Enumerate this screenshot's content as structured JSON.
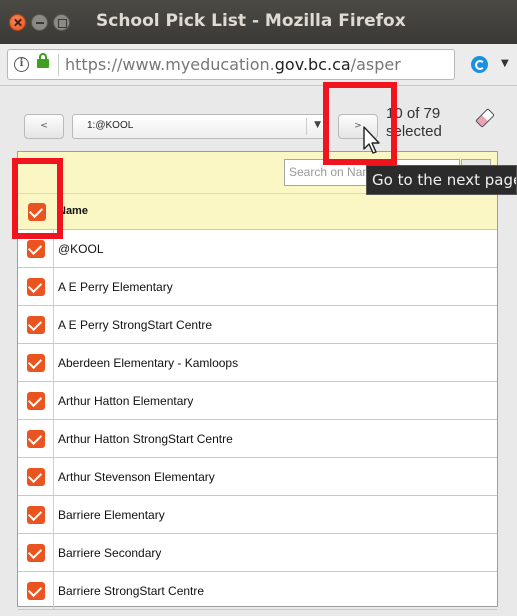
{
  "window": {
    "title": "School Pick List - Mozilla Firefox"
  },
  "urlbar": {
    "url_prefix": "https://www.myeducation.",
    "url_domain": "gov.bc.ca",
    "url_suffix": "/asper"
  },
  "picklist": {
    "prev_label": "<",
    "next_label": ">",
    "selected_option": "1:@KOOL",
    "count_line1": "10 of 79",
    "count_line2": "selected",
    "search_placeholder": "Search on Name",
    "column_header": "Name",
    "header_checked": true,
    "rows": [
      {
        "name": "@KOOL",
        "checked": true
      },
      {
        "name": "A E Perry Elementary",
        "checked": true
      },
      {
        "name": "A E Perry StrongStart Centre",
        "checked": true
      },
      {
        "name": "Aberdeen Elementary - Kamloops",
        "checked": true
      },
      {
        "name": "Arthur Hatton Elementary",
        "checked": true
      },
      {
        "name": "Arthur Hatton StrongStart Centre",
        "checked": true
      },
      {
        "name": "Arthur Stevenson Elementary",
        "checked": true
      },
      {
        "name": "Barriere Elementary",
        "checked": true
      },
      {
        "name": "Barriere Secondary",
        "checked": true
      },
      {
        "name": "Barriere StrongStart Centre",
        "checked": true
      }
    ]
  },
  "tooltip": {
    "text": "Go to the next page"
  },
  "colors": {
    "checkbox": "#e95420",
    "highlight": "#f0141e",
    "header_bg": "#fbf7c5",
    "titlebar": "#3a3935"
  }
}
